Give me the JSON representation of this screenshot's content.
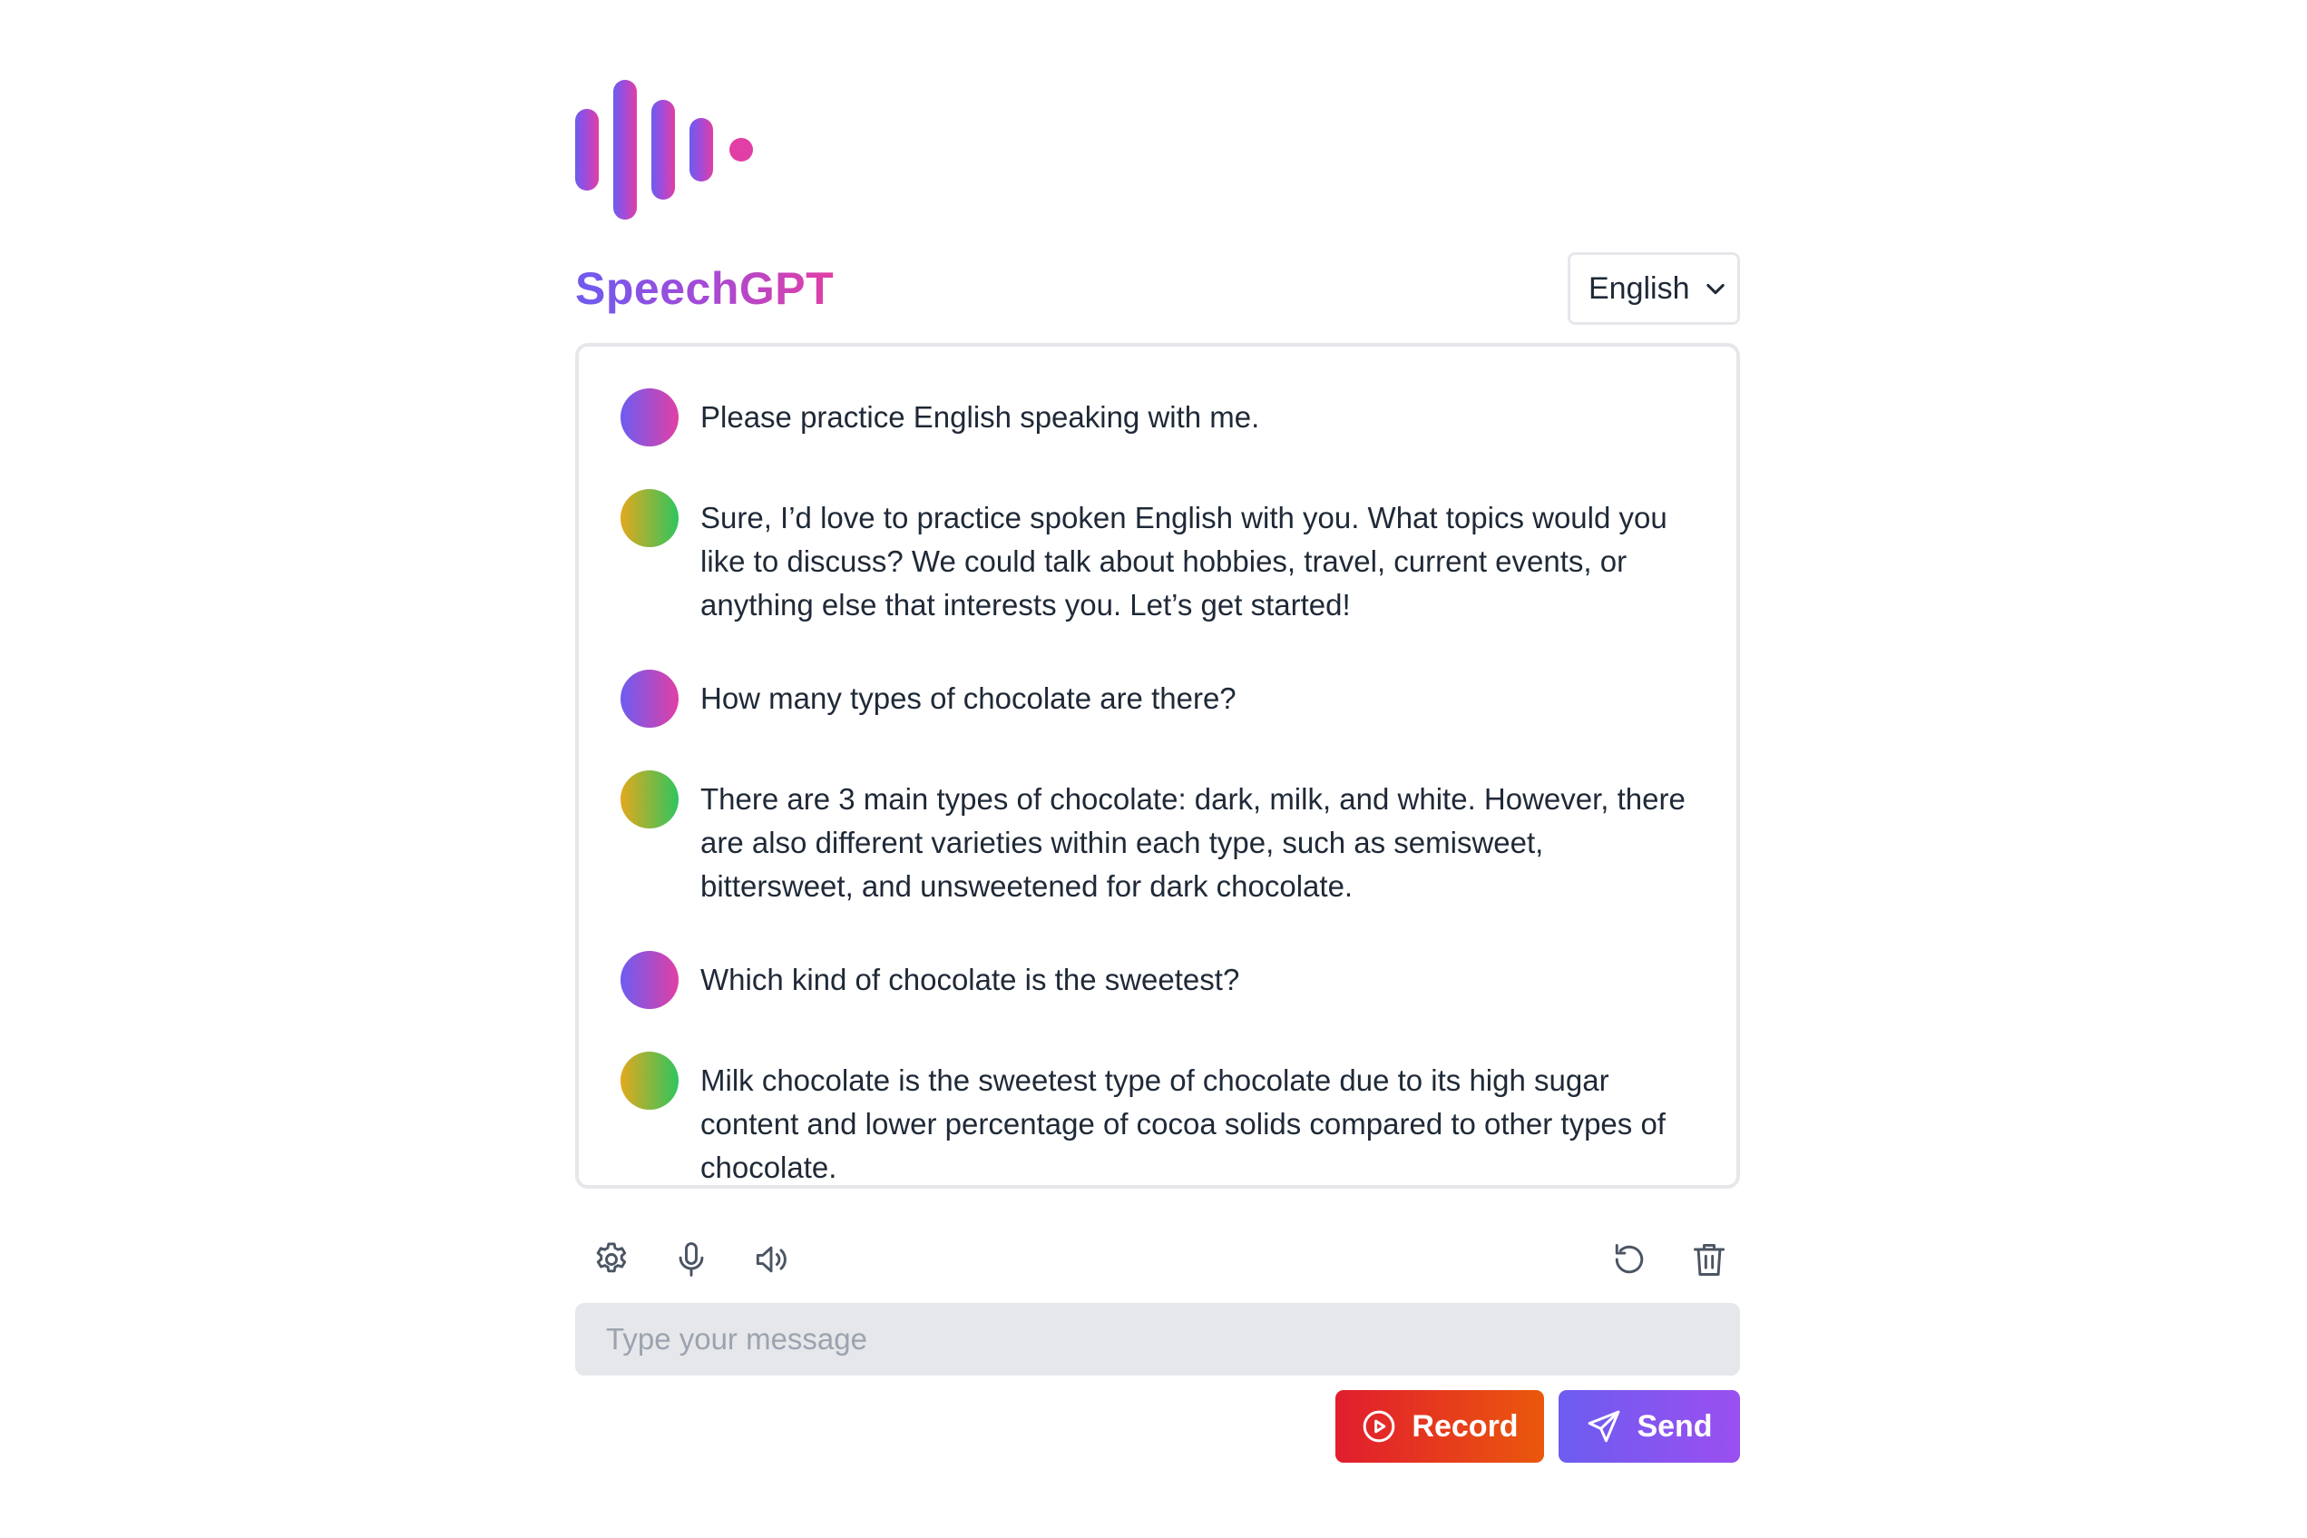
{
  "app": {
    "title": "SpeechGPT",
    "logo_icon": "soundwave-logo-icon"
  },
  "language_select": {
    "value": "English",
    "icon": "chevron-down-icon"
  },
  "messages": [
    {
      "role": "user",
      "text": "Please practice English speaking with me."
    },
    {
      "role": "assistant",
      "text": "Sure, I’d love to practice spoken English with you. What topics would you like to discuss? We could talk about hobbies, travel, current events, or anything else that interests you. Let’s get started!"
    },
    {
      "role": "user",
      "text": "How many types of chocolate are there?"
    },
    {
      "role": "assistant",
      "text": "There are 3 main types of chocolate: dark, milk, and white. However, there are also different varieties within each type, such as semisweet, bittersweet, and unsweetened for dark chocolate."
    },
    {
      "role": "user",
      "text": "Which kind of chocolate is the sweetest?"
    },
    {
      "role": "assistant",
      "text": "Milk chocolate is the sweetest type of chocolate due to its high sugar content and lower percentage of cocoa solids compared to other types of chocolate."
    }
  ],
  "toolbar": {
    "left_icons": [
      "gear-icon",
      "microphone-icon",
      "speaker-icon"
    ],
    "right_icons": [
      "refresh-icon",
      "trash-icon"
    ]
  },
  "input": {
    "value": "",
    "placeholder": "Type your message"
  },
  "buttons": {
    "record_label": "Record",
    "send_label": "Send"
  },
  "colors": {
    "brand_start": "#6d5cf0",
    "brand_end": "#e13fa5",
    "record_start": "#e11d2f",
    "record_end": "#ea580c",
    "send_start": "#6d5cf0",
    "send_end": "#9b4ff0",
    "assistant_avatar_start": "#e3a81c",
    "assistant_avatar_end": "#2ec55f"
  }
}
